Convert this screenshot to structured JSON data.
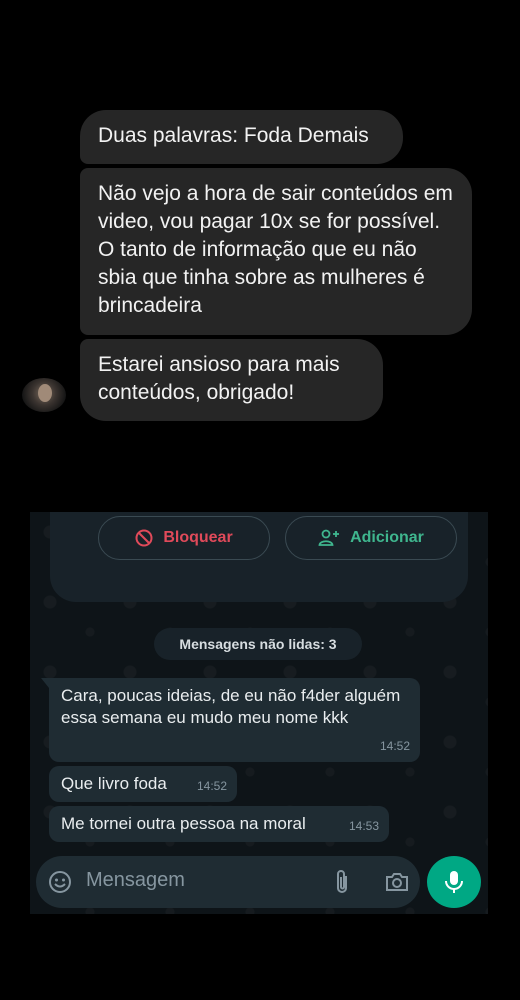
{
  "conversation": {
    "messages": [
      {
        "text": "Duas palavras: Foda Demais"
      },
      {
        "text": "Não vejo a hora de sair conteúdos em video, vou pagar 10x se for possível. O tanto de informação que eu não sbia que tinha sobre as mulheres é brincadeira"
      },
      {
        "text": "Estarei ansioso para mais conteúdos, obrigado!"
      }
    ]
  },
  "whatsapp": {
    "block_label": "Bloquear",
    "add_label": "Adicionar",
    "unread_label": "Mensagens não lidas: 3",
    "messages": [
      {
        "text": "Cara, poucas ideias, de eu não f4der alguém essa semana eu mudo meu nome kkk",
        "time": "14:52"
      },
      {
        "text": "Que livro foda",
        "time": "14:52"
      },
      {
        "text": "Me tornei outra pessoa na moral",
        "time": "14:53"
      }
    ],
    "input_placeholder": "Mensagem",
    "colors": {
      "accent": "#00a884",
      "block": "#e04a5a",
      "add": "#3fb68e"
    }
  }
}
